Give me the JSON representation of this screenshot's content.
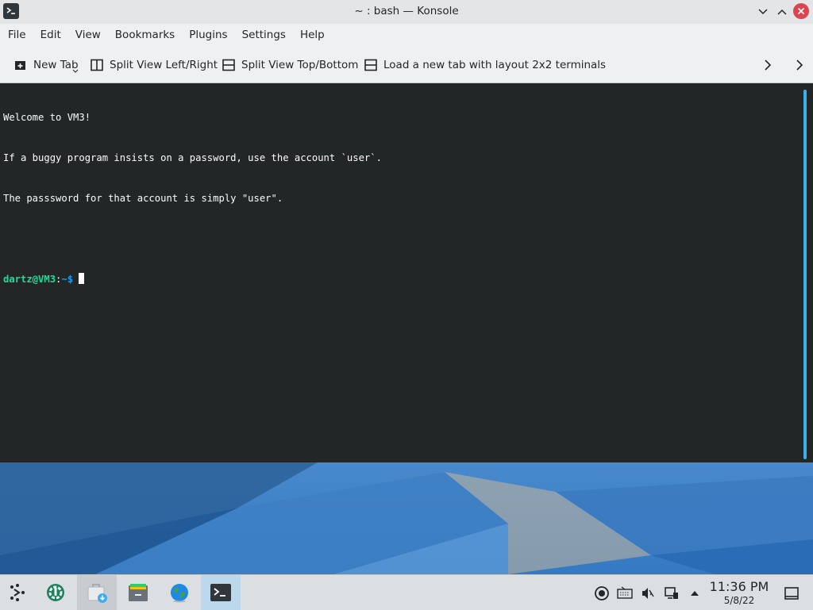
{
  "window": {
    "title": "~ : bash — Konsole"
  },
  "menubar": {
    "items": [
      "File",
      "Edit",
      "View",
      "Bookmarks",
      "Plugins",
      "Settings",
      "Help"
    ]
  },
  "toolbar": {
    "new_tab": "New Tab",
    "split_left_right": "Split View Left/Right",
    "split_top_bottom": "Split View Top/Bottom",
    "load_layout": "Load a new tab with layout 2x2 terminals"
  },
  "terminal": {
    "lines": [
      "Welcome to VM3!",
      "If a buggy program insists on a password, use the account `user`.",
      "The passsword for that account is simply \"user\"."
    ],
    "prompt_user": "dartz@VM3",
    "prompt_sep": ":",
    "prompt_path": "~",
    "prompt_symbol": "$"
  },
  "taskbar": {
    "launcher_icon": "application-launcher-icon",
    "tasks": [
      {
        "icon": "system-settings-icon"
      },
      {
        "icon": "discover-store-icon"
      },
      {
        "icon": "file-manager-icon"
      },
      {
        "icon": "web-browser-icon"
      },
      {
        "icon": "konsole-icon"
      }
    ],
    "tray": [
      "network-sync-icon",
      "keyboard-icon",
      "volume-muted-icon",
      "network-wired-icon",
      "tray-expand-icon"
    ],
    "clock": {
      "time": "11:36 PM",
      "date": "5/8/22"
    }
  },
  "colors": {
    "terminal_bg": "#232627",
    "prompt_user": "#1cdc9a",
    "prompt_path": "#1d99f3",
    "accent": "#3daee9",
    "close_button": "#da4453"
  }
}
